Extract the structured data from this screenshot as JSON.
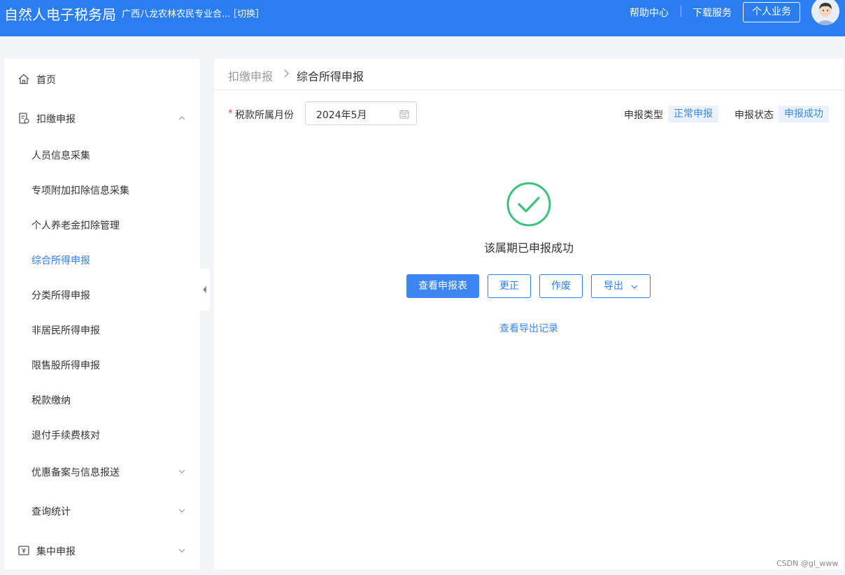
{
  "header": {
    "brand": "自然人电子税务局",
    "org_name": "广西八龙农林农民专业合...",
    "switch_label": "［切换］",
    "help_label": "帮助中心",
    "download_label": "下载服务",
    "personal_label": "个人业务",
    "bg_color": "#2b7ef2"
  },
  "sidebar": {
    "home": "首页",
    "withholding": "扣缴申报",
    "items": [
      "人员信息采集",
      "专项附加扣除信息采集",
      "个人养老金扣除管理",
      "综合所得申报",
      "分类所得申报",
      "非居民所得申报",
      "限售股所得申报",
      "税款缴纳",
      "退付手续费核对",
      "优惠备案与信息报送",
      "查询统计"
    ],
    "centralized": "集中申报",
    "active_item": "综合所得申报"
  },
  "breadcrumb": {
    "parent": "扣缴申报",
    "current": "综合所得申报"
  },
  "form": {
    "required_mark": "*",
    "period_label": "税款所属月份",
    "period_value": "2024年5月",
    "type_label": "申报类型",
    "type_value": "正常申报",
    "status_label": "申报状态",
    "status_value": "申报成功"
  },
  "result": {
    "message": "该属期已申报成功",
    "success_color": "#3cc17c"
  },
  "actions": {
    "view_report": "查看申报表",
    "correct": "更正",
    "void": "作废",
    "export": "导出",
    "export_log": "查看导出记录"
  },
  "watermark": "CSDN @gl_www"
}
